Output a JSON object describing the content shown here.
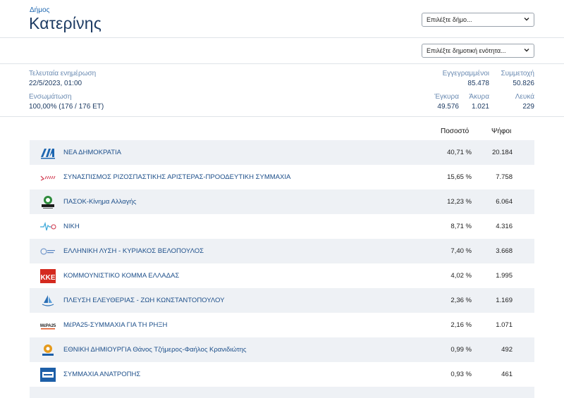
{
  "header": {
    "dimos_label": "Δήμος",
    "dimos_name": "Κατερίνης",
    "select_dimos": "Επιλέξτε δήμο...",
    "select_enotita": "Επιλέξτε δημοτική ενότητα..."
  },
  "info": {
    "last_update_label": "Τελευταία ενημέρωση",
    "last_update_value": "22/5/2023, 01:00",
    "integration_label": "Ενσωμάτωση",
    "integration_value": "100,00% (176 / 176 ΕΤ)",
    "registered_label": "Εγγεγραμμένοι",
    "registered_value": "85.478",
    "turnout_label": "Συμμετοχή",
    "turnout_value": "50.826",
    "valid_label": "Έγκυρα",
    "valid_value": "49.576",
    "invalid_label": "Άκυρα",
    "invalid_value": "1.021",
    "blank_label": "Λευκά",
    "blank_value": "229"
  },
  "table": {
    "col_percent": "Ποσοστό",
    "col_votes": "Ψήφοι",
    "rows": [
      {
        "party": "ΝΕΑ ΔΗΜΟΚΡΑΤΙΑ",
        "percent": "40,71 %",
        "votes": "20.184",
        "icon": "nd-logo-icon",
        "color": "#1d66b0"
      },
      {
        "party": "ΣΥΝΑΣΠΙΣΜΟΣ ΡΙΖΟΣΠΑΣΤΙΚΗΣ ΑΡΙΣΤΕΡΑΣ-ΠΡΟΟΔΕΥΤΙΚΗ ΣΥΜΜΑΧΙΑ",
        "percent": "15,65 %",
        "votes": "7.758",
        "icon": "syriza-logo-icon",
        "color": "#d0344a"
      },
      {
        "party": "ΠΑΣΟΚ-Κίνημα Αλλαγής",
        "percent": "12,23 %",
        "votes": "6.064",
        "icon": "pasok-logo-icon",
        "color": "#2e8b3c"
      },
      {
        "party": "ΝΙΚΗ",
        "percent": "8,71 %",
        "votes": "4.316",
        "icon": "niki-logo-icon",
        "color": "#3aa7d8"
      },
      {
        "party": "ΕΛΛΗΝΙΚΗ ΛΥΣΗ - ΚΥΡΙΑΚΟΣ ΒΕΛΟΠΟΥΛΟΣ",
        "percent": "7,40 %",
        "votes": "3.668",
        "icon": "elliniki-lysi-logo-icon",
        "color": "#5a86c2"
      },
      {
        "party": "ΚΟΜΜΟΥΝΙΣΤΙΚΟ ΚΟΜΜΑ ΕΛΛΑΔΑΣ",
        "percent": "4,02 %",
        "votes": "1.995",
        "icon": "kke-logo-icon",
        "color": "#d42a1f"
      },
      {
        "party": "ΠΛΕΥΣΗ ΕΛΕΥΘΕΡΙΑΣ - ΖΩΗ ΚΩΝΣΤΑΝΤΟΠΟΥΛΟΥ",
        "percent": "2,36 %",
        "votes": "1.169",
        "icon": "plefsi-logo-icon",
        "color": "#2b6fb5"
      },
      {
        "party": "ΜέΡΑ25-ΣΥΜΜΑΧΙΑ ΓΙΑ ΤΗ ΡΗΞΗ",
        "percent": "2,16 %",
        "votes": "1.071",
        "icon": "mera25-logo-icon",
        "color": "#e0531f"
      },
      {
        "party": "ΕΘΝΙΚΗ ΔΗΜΙΟΥΡΓΙΑ Θάνος Τζήμερος-Φαήλος Κρανιδιώτης",
        "percent": "0,99 %",
        "votes": "492",
        "icon": "ethniki-dimiourgia-logo-icon",
        "color": "#e59a1c"
      },
      {
        "party": "ΣΥΜΜΑΧΙΑ ΑΝΑΤΡΟΠΗΣ",
        "percent": "0,93 %",
        "votes": "461",
        "icon": "symmaxia-anatropis-logo-icon",
        "color": "#1d5fa8"
      }
    ]
  }
}
